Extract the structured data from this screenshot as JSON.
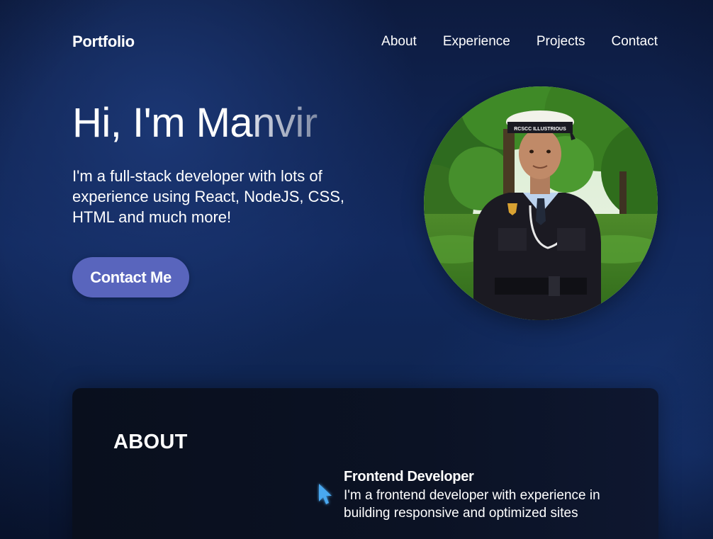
{
  "nav": {
    "brand": "Portfolio",
    "links": [
      "About",
      "Experience",
      "Projects",
      "Contact"
    ]
  },
  "hero": {
    "greeting_typed": "Hi, I'm Ma",
    "greeting_fading": "nvir",
    "subtitle": "I'm a full-stack developer with lots of experience using React, NodeJS, CSS, HTML and much more!",
    "cta_label": "Contact Me",
    "portrait_icon": "profile-photo"
  },
  "about": {
    "title": "ABOUT",
    "items": [
      {
        "icon": "cursor-icon",
        "title": "Frontend Developer",
        "description": "I'm a frontend developer with experience in building responsive and optimized sites"
      }
    ]
  },
  "colors": {
    "background": "#12295e",
    "accent_button": "#5965bd",
    "card": "#0b1224",
    "cursor_icon": "#4aa8f0"
  }
}
